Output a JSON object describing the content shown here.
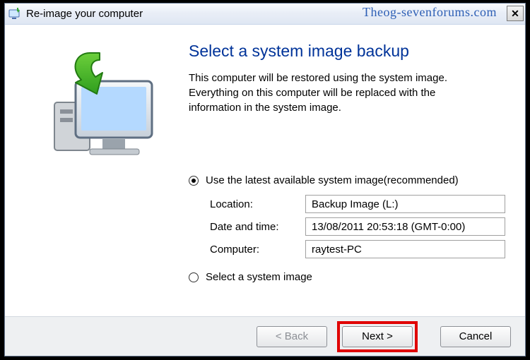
{
  "window": {
    "title": "Re-image your computer",
    "watermark": "Theog-sevenforums.com",
    "close_glyph": "✕"
  },
  "main": {
    "heading": "Select a system image backup",
    "description": "This computer will be restored using the system image. Everything on this computer will be replaced with the information in the system image."
  },
  "options": {
    "use_latest_label": "Use the latest available system image(recommended)",
    "select_image_label": "Select a system image",
    "fields": {
      "location_label": "Location:",
      "location_value": "Backup Image (L:)",
      "datetime_label": "Date and time:",
      "datetime_value": "13/08/2011 20:53:18 (GMT-0:00)",
      "computer_label": "Computer:",
      "computer_value": "raytest-PC"
    }
  },
  "buttons": {
    "back": "< Back",
    "next": "Next >",
    "cancel": "Cancel"
  }
}
